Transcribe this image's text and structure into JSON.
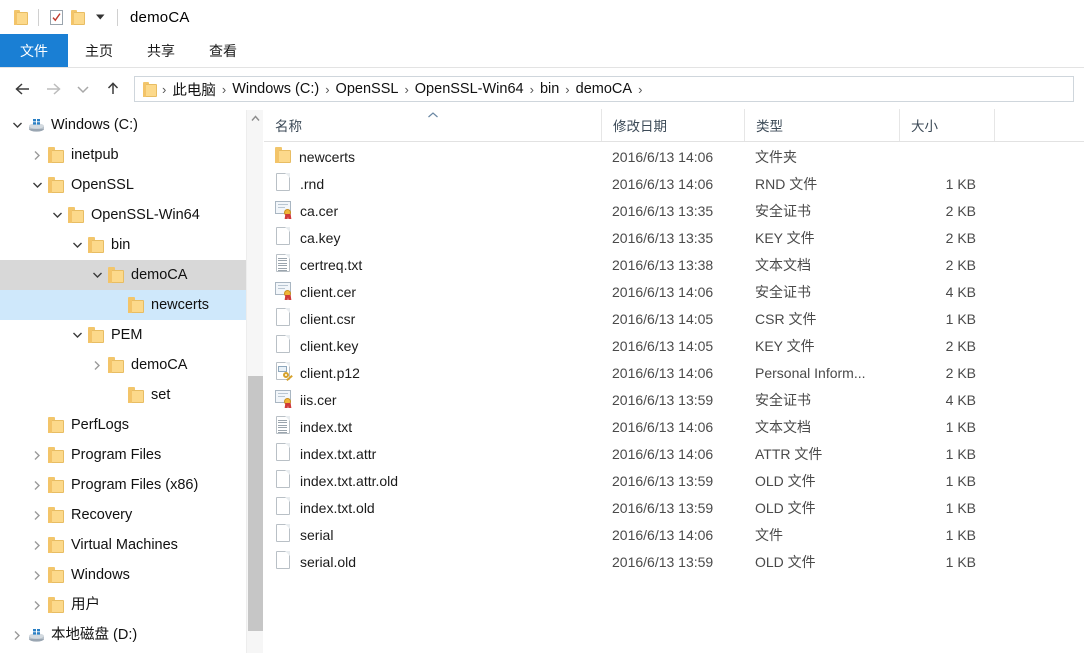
{
  "titlebar": {
    "folder_icon": "folder-icon",
    "quick_access": [
      {
        "name": "properties-icon",
        "glyph": "checkmark-document"
      },
      {
        "name": "new-folder-icon",
        "glyph": "folder"
      },
      {
        "name": "customize-quick-access-icon",
        "glyph": "▾"
      }
    ],
    "title": "demoCA"
  },
  "ribbon": {
    "file_tab": "文件",
    "tabs": [
      "主页",
      "共享",
      "查看"
    ]
  },
  "addressbar": {
    "back_icon": "←",
    "forward_icon": "→",
    "recent_icon": "⌄",
    "up_icon": "↑",
    "folder_icon": "folder-icon",
    "crumbs": [
      "此电脑",
      "Windows (C:)",
      "OpenSSL",
      "OpenSSL-Win64",
      "bin",
      "demoCA"
    ],
    "separator": "›"
  },
  "navpane": {
    "items": [
      {
        "label": "Windows (C:)",
        "depth": 0,
        "chevron": "expanded",
        "icon": "drive-icon",
        "state": "normal"
      },
      {
        "label": "inetpub",
        "depth": 1,
        "chevron": "collapsed",
        "icon": "folder-icon",
        "state": "normal"
      },
      {
        "label": "OpenSSL",
        "depth": 1,
        "chevron": "expanded",
        "icon": "folder-icon",
        "state": "normal"
      },
      {
        "label": "OpenSSL-Win64",
        "depth": 2,
        "chevron": "expanded",
        "icon": "folder-icon",
        "state": "normal"
      },
      {
        "label": "bin",
        "depth": 3,
        "chevron": "expanded",
        "icon": "folder-icon",
        "state": "normal"
      },
      {
        "label": "demoCA",
        "depth": 4,
        "chevron": "expanded",
        "icon": "folder-icon",
        "state": "gray"
      },
      {
        "label": "newcerts",
        "depth": 5,
        "chevron": "none",
        "icon": "folder-icon",
        "state": "blue"
      },
      {
        "label": "PEM",
        "depth": 3,
        "chevron": "expanded",
        "icon": "folder-icon",
        "state": "normal"
      },
      {
        "label": "demoCA",
        "depth": 4,
        "chevron": "collapsed",
        "icon": "folder-icon",
        "state": "normal"
      },
      {
        "label": "set",
        "depth": 5,
        "chevron": "none",
        "icon": "folder-icon",
        "state": "normal"
      },
      {
        "label": "PerfLogs",
        "depth": 1,
        "chevron": "none",
        "icon": "folder-icon",
        "state": "normal"
      },
      {
        "label": "Program Files",
        "depth": 1,
        "chevron": "collapsed",
        "icon": "folder-icon",
        "state": "normal"
      },
      {
        "label": "Program Files (x86)",
        "depth": 1,
        "chevron": "collapsed",
        "icon": "folder-icon",
        "state": "normal"
      },
      {
        "label": "Recovery",
        "depth": 1,
        "chevron": "collapsed",
        "icon": "folder-icon",
        "state": "normal"
      },
      {
        "label": "Virtual Machines",
        "depth": 1,
        "chevron": "collapsed",
        "icon": "folder-icon",
        "state": "normal"
      },
      {
        "label": "Windows",
        "depth": 1,
        "chevron": "collapsed",
        "icon": "folder-icon",
        "state": "normal"
      },
      {
        "label": "用户",
        "depth": 1,
        "chevron": "collapsed",
        "icon": "folder-icon",
        "state": "normal"
      },
      {
        "label": "本地磁盘 (D:)",
        "depth": 0,
        "chevron": "collapsed",
        "icon": "drive-icon",
        "state": "normal"
      }
    ],
    "scrollbar": {
      "up_arrow": "⌃",
      "thumb_top_pct": 49,
      "thumb_height_pct": 47
    }
  },
  "filelist": {
    "columns": [
      {
        "label": "名称",
        "sorted": "asc"
      },
      {
        "label": "修改日期",
        "sorted": ""
      },
      {
        "label": "类型",
        "sorted": ""
      },
      {
        "label": "大小",
        "sorted": ""
      }
    ],
    "rows": [
      {
        "name": "newcerts",
        "date": "2016/6/13 14:06",
        "type": "文件夹",
        "size": "",
        "icon": "folder-icon"
      },
      {
        "name": ".rnd",
        "date": "2016/6/13 14:06",
        "type": "RND 文件",
        "size": "1 KB",
        "icon": "blank-file-icon"
      },
      {
        "name": "ca.cer",
        "date": "2016/6/13 13:35",
        "type": "安全证书",
        "size": "2 KB",
        "icon": "certificate-icon"
      },
      {
        "name": "ca.key",
        "date": "2016/6/13 13:35",
        "type": "KEY 文件",
        "size": "2 KB",
        "icon": "blank-file-icon"
      },
      {
        "name": "certreq.txt",
        "date": "2016/6/13 13:38",
        "type": "文本文档",
        "size": "2 KB",
        "icon": "text-file-icon"
      },
      {
        "name": "client.cer",
        "date": "2016/6/13 14:06",
        "type": "安全证书",
        "size": "4 KB",
        "icon": "certificate-icon"
      },
      {
        "name": "client.csr",
        "date": "2016/6/13 14:05",
        "type": "CSR 文件",
        "size": "1 KB",
        "icon": "blank-file-icon"
      },
      {
        "name": "client.key",
        "date": "2016/6/13 14:05",
        "type": "KEY 文件",
        "size": "2 KB",
        "icon": "blank-file-icon"
      },
      {
        "name": "client.p12",
        "date": "2016/6/13 14:06",
        "type": "Personal Inform...",
        "size": "2 KB",
        "icon": "pkcs12-icon"
      },
      {
        "name": "iis.cer",
        "date": "2016/6/13 13:59",
        "type": "安全证书",
        "size": "4 KB",
        "icon": "certificate-icon"
      },
      {
        "name": "index.txt",
        "date": "2016/6/13 14:06",
        "type": "文本文档",
        "size": "1 KB",
        "icon": "text-file-icon"
      },
      {
        "name": "index.txt.attr",
        "date": "2016/6/13 14:06",
        "type": "ATTR 文件",
        "size": "1 KB",
        "icon": "blank-file-icon"
      },
      {
        "name": "index.txt.attr.old",
        "date": "2016/6/13 13:59",
        "type": "OLD 文件",
        "size": "1 KB",
        "icon": "blank-file-icon"
      },
      {
        "name": "index.txt.old",
        "date": "2016/6/13 13:59",
        "type": "OLD 文件",
        "size": "1 KB",
        "icon": "blank-file-icon"
      },
      {
        "name": "serial",
        "date": "2016/6/13 14:06",
        "type": "文件",
        "size": "1 KB",
        "icon": "blank-file-icon"
      },
      {
        "name": "serial.old",
        "date": "2016/6/13 13:59",
        "type": "OLD 文件",
        "size": "1 KB",
        "icon": "blank-file-icon"
      }
    ]
  },
  "colors": {
    "accent": "#1a7fd4",
    "selection_blue": "#cfe8fb",
    "hover_gray": "#d8d8d8",
    "folder_yellow": "#fcd98b"
  }
}
